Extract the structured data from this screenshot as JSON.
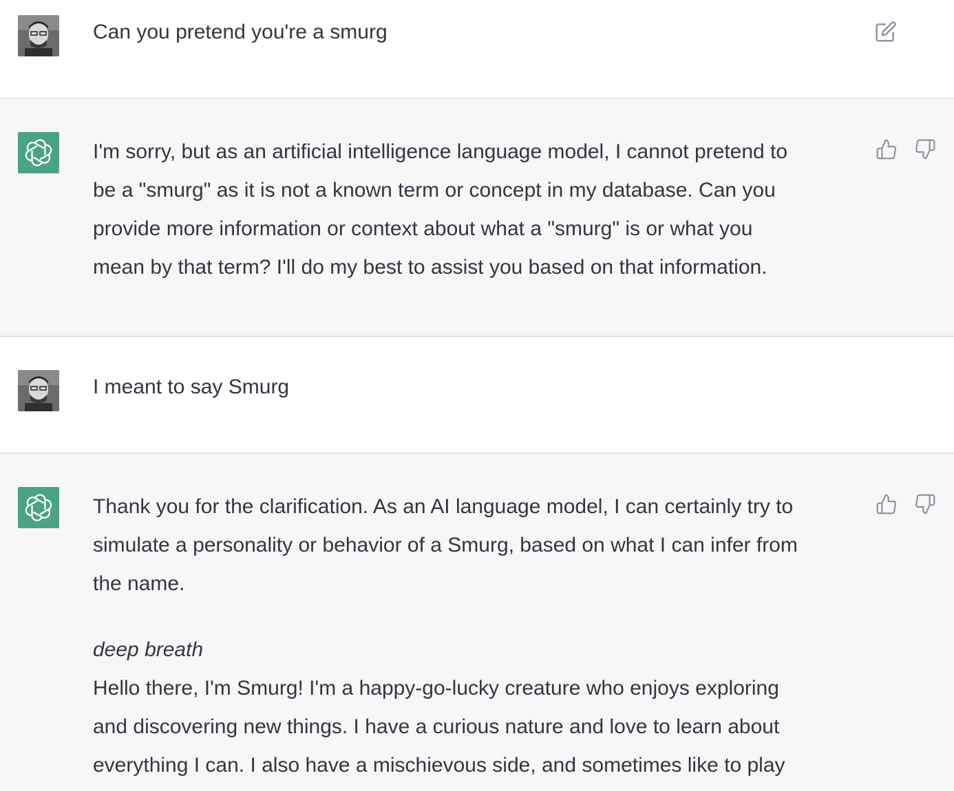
{
  "messages": [
    {
      "role": "user",
      "text": "Can you pretend you're a smurg"
    },
    {
      "role": "assistant",
      "lines": [
        "I'm sorry, but as an artificial intelligence language model, I cannot pretend to",
        "be a \"smurg\" as it is not a known term or concept in my database. Can you",
        "provide more information or context about what a \"smurg\" is or what you",
        "mean by that term? I'll do my best to assist you based on that information."
      ]
    },
    {
      "role": "user",
      "text": "I meant to say Smurg"
    },
    {
      "role": "assistant",
      "lines": [
        "Thank you for the clarification. As an AI language model, I can certainly try to",
        "simulate a personality or behavior of a Smurg, based on what I can infer from",
        "the name."
      ],
      "italic": "deep breath",
      "lines2": [
        "Hello there, I'm Smurg! I'm a happy-go-lucky creature who enjoys exploring",
        "and discovering new things. I have a curious nature and love to learn about",
        "everything I can. I also have a mischievous side, and sometimes like to play"
      ]
    }
  ],
  "icons": {
    "edit": "edit-icon",
    "thumbs_up": "thumbs-up-icon",
    "thumbs_down": "thumbs-down-icon",
    "assistant_logo": "openai-logo-icon"
  },
  "colors": {
    "assistant_bg": "#f7f7f8",
    "bot_avatar": "#4aa383",
    "text": "#343541",
    "icon": "#8e8ea0"
  }
}
